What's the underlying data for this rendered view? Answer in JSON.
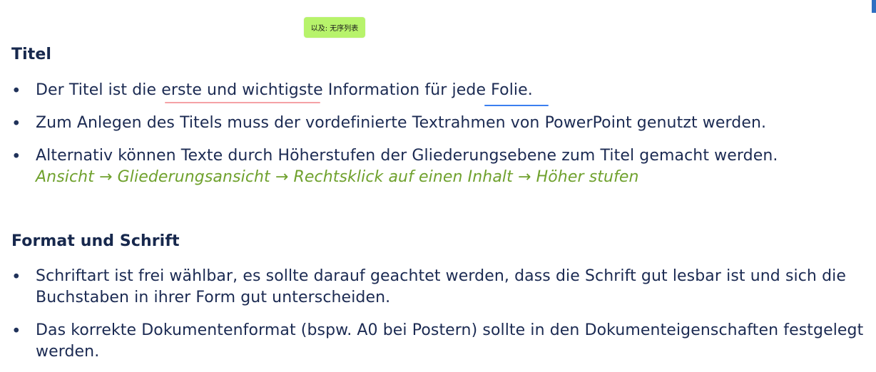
{
  "tooltip": {
    "text": "以及: 无序列表"
  },
  "sections": [
    {
      "title": "Titel",
      "items": [
        {
          "text": "Der Titel ist die erste und wichtigste Information für jede Folie."
        },
        {
          "text": "Zum Anlegen des Titels muss der vordefinierte Textrahmen von PowerPoint genutzt werden."
        },
        {
          "text": "Alternativ können Texte durch Höherstufen der Gliederungsebene zum Titel gemacht werden.",
          "path": "Ansicht → Gliederungsansicht → Rechtsklick auf einen Inhalt → Höher stufen"
        }
      ]
    },
    {
      "title": "Format und Schrift",
      "items": [
        {
          "text": "Schriftart ist frei wählbar, es sollte darauf geachtet werden, dass die Schrift gut lesbar ist und sich die Buchstaben in ihrer Form gut unterscheiden."
        },
        {
          "text": "Das korrekte Dokumentenformat (bspw. A0 bei Postern) sollte in den Dokumenteigenschaften festgelegt werden."
        }
      ]
    }
  ],
  "bullet_symbol": "•",
  "colors": {
    "text": "#1b2a52",
    "heading": "#17284d",
    "path": "#6fa12d",
    "tooltip": "#b7f36b",
    "pink_underline": "#f5a2a6",
    "blue_underline": "#3b7ff0"
  }
}
